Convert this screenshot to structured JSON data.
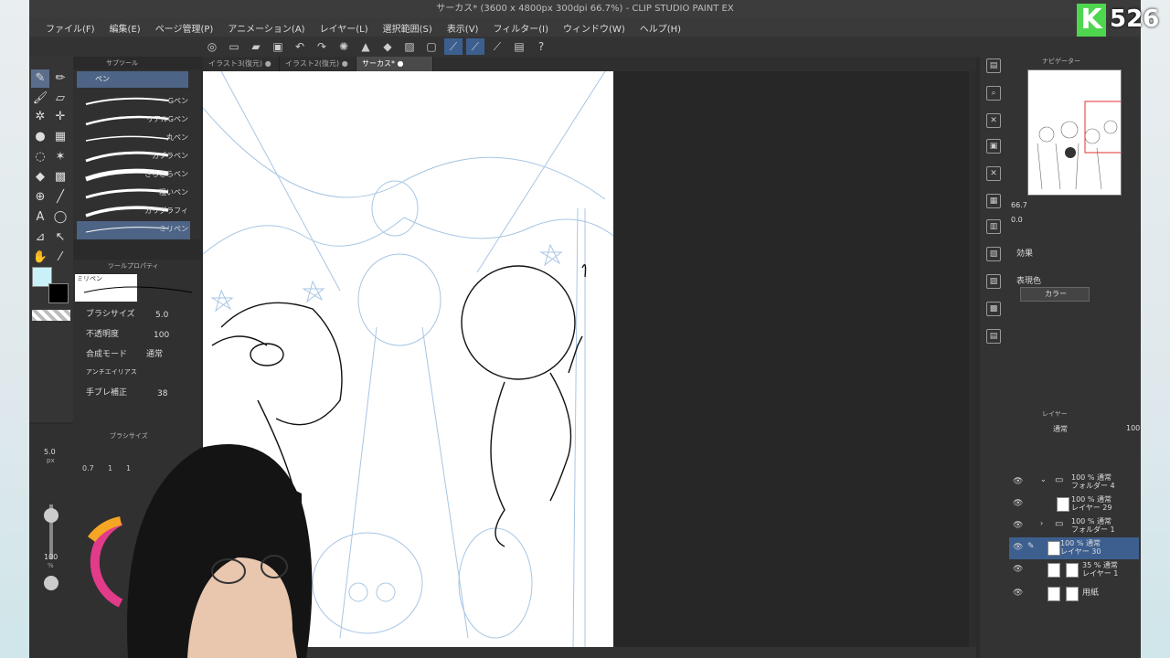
{
  "window": {
    "title": "サーカス* (3600 x 4800px 300dpi 66.7%) - CLIP STUDIO PAINT EX"
  },
  "menu": [
    "ファイル(F)",
    "編集(E)",
    "ページ管理(P)",
    "アニメーション(A)",
    "レイヤー(L)",
    "選択範囲(S)",
    "表示(V)",
    "フィルター(I)",
    "ウィンドウ(W)",
    "ヘルプ(H)"
  ],
  "tabs": [
    {
      "label": "イラスト3(復元)"
    },
    {
      "label": "イラスト2(復元)"
    },
    {
      "label": "サーカス*"
    }
  ],
  "subtool": {
    "header": "サブツール",
    "active_group": "ペン",
    "pens": [
      "Gペン",
      "リアルGペン",
      "丸ペン",
      "カブラペン",
      "さらさらペン",
      "粗いペン",
      "カリグラフィ",
      "ミリペン"
    ]
  },
  "tool_property": {
    "header": "ツールプロパティ",
    "current": "ミリペン",
    "brush_size_label": "ブラシサイズ",
    "brush_size": "5.0",
    "opacity_label": "不透明度",
    "opacity": "100",
    "blend_label": "合成モード",
    "blend": "通常",
    "antialias_label": "アンチエイリアス",
    "stabilize_label": "手ブレ補正",
    "stabilize": "38"
  },
  "brush_size_panel": {
    "header": "ブラシサイズ",
    "size": "5.0",
    "unit": "px",
    "presets": [
      "0.7",
      "1",
      "1"
    ],
    "opacity": "100",
    "opacity_unit": "%"
  },
  "navigator": {
    "header": "ナビゲーター",
    "zoom": "66.7",
    "rotation": "0.0"
  },
  "property_panel": {
    "effect_label": "効果",
    "display_color_label": "表現色",
    "display_color": "カラー"
  },
  "layers_panel": {
    "header": "レイヤー",
    "blend": "通常",
    "opacity": "100",
    "layers": [
      {
        "mode": "100 % 通常",
        "name": "フォルダー 4",
        "type": "folder",
        "active": false
      },
      {
        "mode": "100 % 通常",
        "name": "レイヤー 29",
        "type": "raster",
        "active": false
      },
      {
        "mode": "100 % 通常",
        "name": "フォルダー 1",
        "type": "folder",
        "active": false
      },
      {
        "mode": "100 % 通常",
        "name": "レイヤー 30",
        "type": "raster",
        "active": true
      },
      {
        "mode": "35 % 通常",
        "name": "レイヤー 1",
        "type": "raster",
        "active": false
      },
      {
        "mode": "",
        "name": "用紙",
        "type": "paper",
        "active": false
      }
    ]
  },
  "badge": {
    "letter": "K",
    "number": "526",
    "color": "#4fd64f"
  },
  "colors": {
    "accent": "#3d5f8f",
    "main_color": "#c9f2f8",
    "sub_color": "#000000"
  }
}
